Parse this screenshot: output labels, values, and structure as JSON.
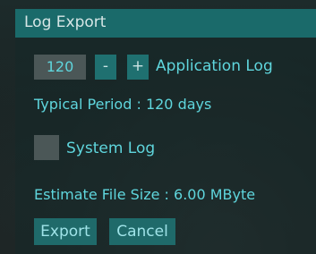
{
  "dialog": {
    "title": "Log Export"
  },
  "application_log": {
    "period_value": "120",
    "minus_label": "-",
    "plus_label": "+",
    "label": "Application Log",
    "typical_period_text": "Typical Period : 120 days"
  },
  "system_log": {
    "label": "System Log",
    "checked": false
  },
  "estimate": {
    "text": "Estimate File Size : 6.00 MByte"
  },
  "actions": {
    "export_label": "Export",
    "cancel_label": "Cancel"
  },
  "colors": {
    "titlebar": "#1a6a6a",
    "accent_text": "#5fd6dd",
    "button_bg": "#1f6a6a",
    "field_bg": "#4b5757"
  }
}
